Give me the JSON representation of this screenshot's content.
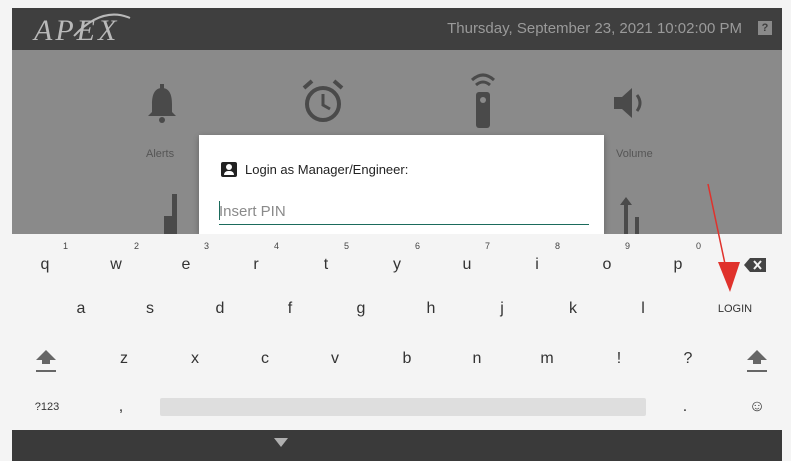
{
  "header": {
    "logo_text": "APEX",
    "datetime": "Thursday, September 23, 2021 10:02:00 PM",
    "help_glyph": "?"
  },
  "background_menu": {
    "items": [
      {
        "label": "Alerts",
        "icon": "bell-icon"
      },
      {
        "label": "",
        "icon": "alarm-clock-icon"
      },
      {
        "label": "",
        "icon": "remote-icon"
      },
      {
        "label": "Volume",
        "icon": "speaker-icon"
      }
    ]
  },
  "dialog": {
    "title": "Login as Manager/Engineer:",
    "pin_placeholder": "Insert PIN",
    "icon": "account-box-icon"
  },
  "keyboard": {
    "row1": [
      {
        "key": "q",
        "hint": "1"
      },
      {
        "key": "w",
        "hint": "2"
      },
      {
        "key": "e",
        "hint": "3"
      },
      {
        "key": "r",
        "hint": "4"
      },
      {
        "key": "t",
        "hint": "5"
      },
      {
        "key": "y",
        "hint": "6"
      },
      {
        "key": "u",
        "hint": "7"
      },
      {
        "key": "i",
        "hint": "8"
      },
      {
        "key": "o",
        "hint": "9"
      },
      {
        "key": "p",
        "hint": "0"
      }
    ],
    "row2": [
      "a",
      "s",
      "d",
      "f",
      "g",
      "h",
      "j",
      "k",
      "l"
    ],
    "row3": [
      "z",
      "x",
      "c",
      "v",
      "b",
      "n",
      "m",
      "!",
      "?"
    ],
    "login_label": "LOGIN",
    "symbols_label": "?123",
    "comma_label": ",",
    "period_label": ".",
    "emoji_glyph": "☺",
    "backspace_icon": "backspace-icon",
    "shift_icon": "shift-icon"
  },
  "colors": {
    "topbar": "#3f3f3f",
    "dim_overlay": "#8a8a8a",
    "input_underline": "#1b6b5c",
    "annotation_arrow": "#e0322c"
  }
}
